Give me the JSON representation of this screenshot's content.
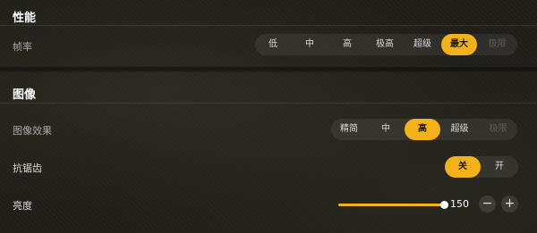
{
  "performance": {
    "title": "性能",
    "frame_rate": {
      "label": "帧率",
      "options": [
        "低",
        "中",
        "高",
        "极高",
        "超级",
        "最大",
        "极限"
      ],
      "selected": "最大",
      "disabled": [
        "极限"
      ]
    }
  },
  "graphics": {
    "title": "图像",
    "quality": {
      "label": "图像效果",
      "options": [
        "精简",
        "中",
        "高",
        "超级",
        "极限"
      ],
      "selected": "高",
      "disabled": [
        "极限"
      ]
    },
    "anti_aliasing": {
      "label": "抗锯齿",
      "options": [
        "关",
        "开"
      ],
      "selected": "关"
    },
    "brightness": {
      "label": "亮度",
      "value": "150",
      "level": 1.0,
      "minus_icon": "minus-icon",
      "plus_icon": "plus-icon"
    }
  },
  "colors": {
    "accent": "#f3b11b",
    "background": "#1f1e18"
  }
}
